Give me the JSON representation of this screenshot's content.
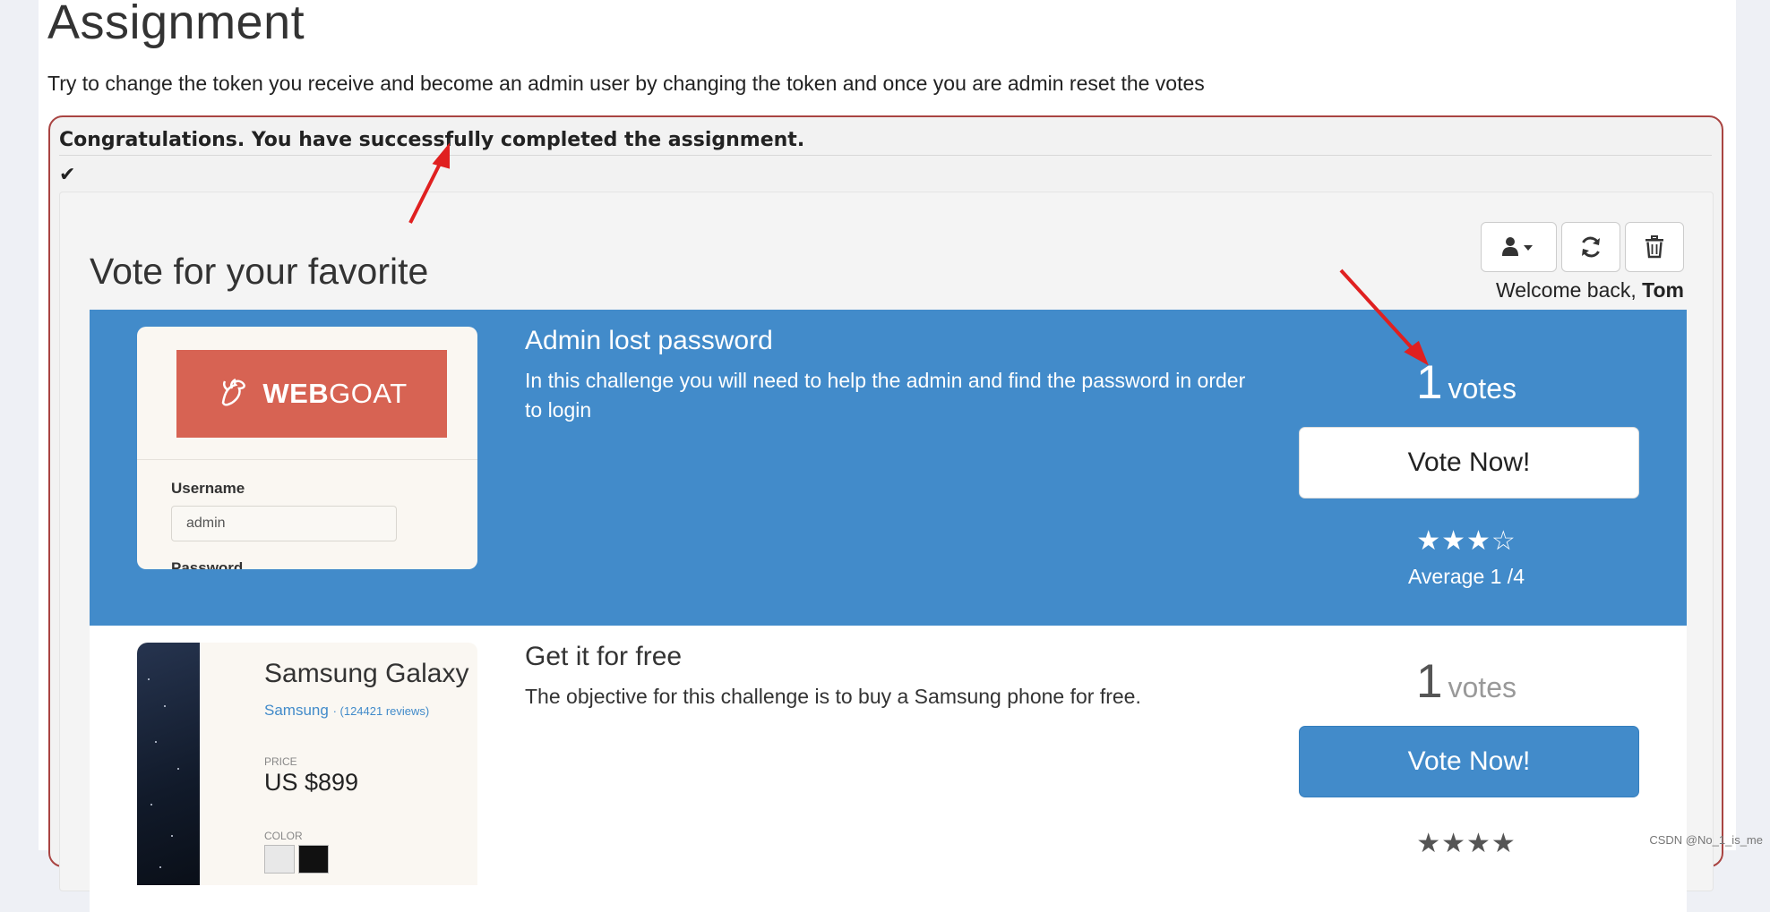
{
  "assignment": {
    "title": "Assignment",
    "description": "Try to change the token you receive and become an admin user by changing the token and once you are admin reset the votes"
  },
  "feedback": {
    "message": "Congratulations. You have successfully completed the assignment.",
    "check_icon": "✔"
  },
  "voting": {
    "title": "Vote for your favorite",
    "welcome_prefix": "Welcome back, ",
    "user": "Tom",
    "toolbar": [
      "user-icon",
      "refresh-icon",
      "trash-icon"
    ]
  },
  "challenges": [
    {
      "title": "Admin lost password",
      "description": "In this challenge you will need to help the admin and find the password in order to login",
      "votes": "1",
      "votes_label": "votes",
      "vote_button": "Vote Now!",
      "stars": "★★★☆",
      "average": "Average 1 /4",
      "thumb": {
        "logo_web": "WEB",
        "logo_goat": "GOAT",
        "username_label": "Username",
        "username_value": "admin",
        "password_label": "Password"
      }
    },
    {
      "title": "Get it for free",
      "description": "The objective for this challenge is to buy a Samsung phone for free.",
      "votes": "1",
      "votes_label": "votes",
      "vote_button": "Vote Now!",
      "thumb": {
        "product": "Samsung Galaxy",
        "brand": "Samsung",
        "reviews": "· (124421 reviews)",
        "price_label": "PRICE",
        "price": "US $899",
        "color_label": "COLOR"
      }
    }
  ],
  "watermark": "CSDN @No_1_is_me",
  "colors": {
    "accent": "#428bca",
    "error_border": "#a94442",
    "annotation": "#e02020",
    "webgoat": "#d76353"
  }
}
